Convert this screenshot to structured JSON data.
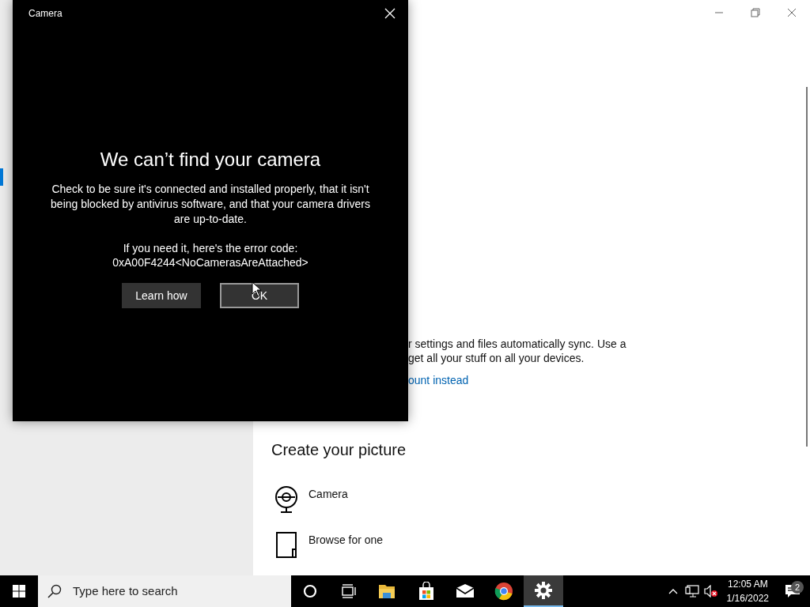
{
  "settings_window": {
    "sync_lines": [
      "r settings and files automatically sync. Use a",
      "get all your stuff on all your devices."
    ],
    "link": "ount instead",
    "section_title": "Create your picture",
    "options": [
      {
        "kind": "camera",
        "label": "Camera"
      },
      {
        "kind": "browse",
        "label": "Browse for one"
      }
    ]
  },
  "camera_dialog": {
    "title": "Camera",
    "heading": "We can’t find your camera",
    "message": "Check to be sure it's connected and installed properly, that it isn't being blocked by antivirus software, and that your camera drivers are up-to-date.",
    "error_intro": "If you need it, here's the error code:",
    "error_code": "0xA00F4244<NoCamerasAreAttached>",
    "buttons": [
      {
        "label": "Learn how",
        "focused": false
      },
      {
        "label": "OK",
        "focused": true
      }
    ]
  },
  "taskbar": {
    "search": {
      "placeholder": "Type here to search"
    },
    "apps": [
      {
        "kind": "cortana",
        "selected": false
      },
      {
        "kind": "task-view",
        "selected": false
      },
      {
        "kind": "folder",
        "selected": false
      },
      {
        "kind": "store",
        "selected": false
      },
      {
        "kind": "mail",
        "selected": false
      },
      {
        "kind": "browser",
        "selected": false
      },
      {
        "kind": "settings",
        "selected": true
      }
    ],
    "clock": {
      "time": "12:05 AM",
      "date": "1/16/2022"
    },
    "notifications": {
      "count": "2"
    }
  }
}
